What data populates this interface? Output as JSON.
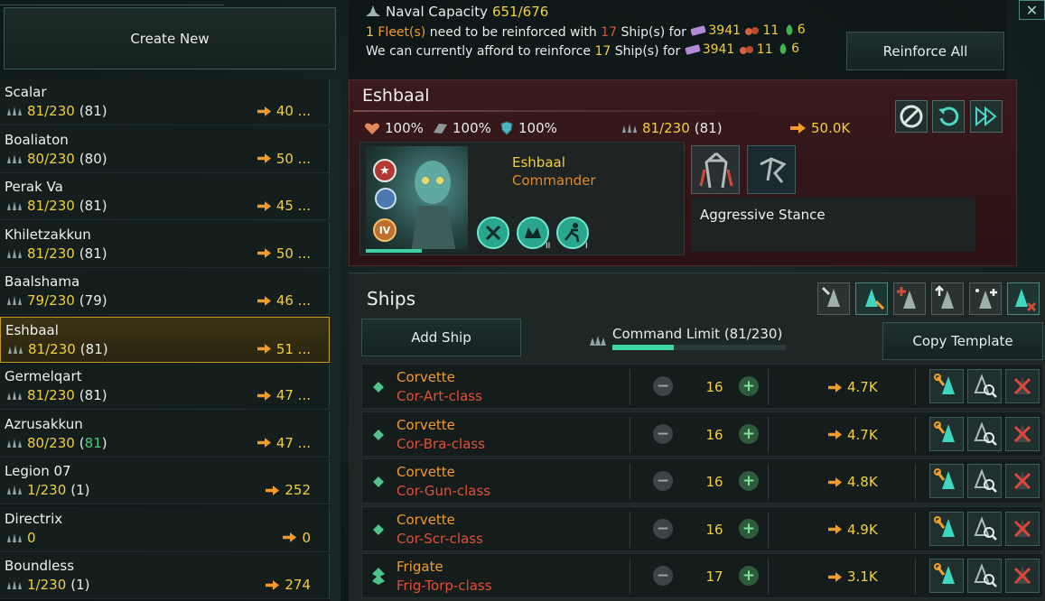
{
  "left": {
    "create_new_label": "Create New",
    "fleets": [
      {
        "name": "Scalar",
        "used": "81",
        "cap": "230",
        "extra": "81",
        "power": "40 ..."
      },
      {
        "name": "Boaliaton",
        "used": "80",
        "cap": "230",
        "extra": "80",
        "power": "50 ..."
      },
      {
        "name": "Perak Va",
        "used": "81",
        "cap": "230",
        "extra": "81",
        "power": "45 ..."
      },
      {
        "name": "Khiletzakkun",
        "used": "81",
        "cap": "230",
        "extra": "81",
        "power": "50 ..."
      },
      {
        "name": "Baalshama",
        "used": "79",
        "cap": "230",
        "extra": "79",
        "power": "46 ..."
      },
      {
        "name": "Eshbaal",
        "used": "81",
        "cap": "230",
        "extra": "81",
        "power": "51 ...",
        "selected": true
      },
      {
        "name": "Germelqart",
        "used": "81",
        "cap": "230",
        "extra": "81",
        "power": "47 ..."
      },
      {
        "name": "Azrusakkun",
        "used": "80",
        "cap": "230",
        "extra": "81",
        "power": "47 ...",
        "extra_green": true
      },
      {
        "name": "Legion 07",
        "used": "1",
        "cap": "230",
        "extra": "1",
        "power": "252"
      },
      {
        "name": "Directrix",
        "used": "0",
        "cap": "",
        "extra": "",
        "power": "0"
      },
      {
        "name": "Boundless",
        "used": "1",
        "cap": "230",
        "extra": "1",
        "power": "274"
      }
    ]
  },
  "top": {
    "naval_label": "Naval Capacity",
    "naval_value": "651/676",
    "line1_a": "1",
    "line1_b": "Fleet(s)",
    "line1_c": "need to be reinforced with",
    "line1_d": "17",
    "line1_e": "Ship(s) for",
    "line2_a": "We can currently afford to reinforce",
    "line2_b": "17",
    "line2_c": "Ship(s) for",
    "cost_alloys": "3941",
    "cost_minerals": "11",
    "cost_food": "6",
    "reinforce_all_label": "Reinforce All",
    "close_label": "✕"
  },
  "fleet": {
    "name": "Eshbaal",
    "hull": "100%",
    "armor": "100%",
    "shield": "100%",
    "size": "81/230",
    "size_extra": "(81)",
    "power": "50.0K",
    "commander_name": "Eshbaal",
    "commander_role": "Commander",
    "commander_level": "IV",
    "trait2_rank": "II",
    "trait3_rank": "I",
    "stance_label": "Aggressive Stance"
  },
  "ships": {
    "title": "Ships",
    "add_ship_label": "Add Ship",
    "command_limit_label": "Command Limit (81/230)",
    "command_limit_fraction": 0.352,
    "copy_template_label": "Copy Template",
    "rows": [
      {
        "type": "Corvette",
        "class": "Cor-Art-class",
        "count": "16",
        "power": "4.7K",
        "tier": "corvette"
      },
      {
        "type": "Corvette",
        "class": "Cor-Bra-class",
        "count": "16",
        "power": "4.7K",
        "tier": "corvette"
      },
      {
        "type": "Corvette",
        "class": "Cor-Gun-class",
        "count": "16",
        "power": "4.8K",
        "tier": "corvette"
      },
      {
        "type": "Corvette",
        "class": "Cor-Scr-class",
        "count": "16",
        "power": "4.9K",
        "tier": "corvette"
      },
      {
        "type": "Frigate",
        "class": "Frig-Torp-class",
        "count": "17",
        "power": "3.1K",
        "tier": "frigate"
      }
    ]
  },
  "colors": {
    "accent": "#f3cf3a",
    "orange": "#f39a2c",
    "red": "#e05037",
    "green": "#43c976",
    "panel": "#131e1d"
  }
}
